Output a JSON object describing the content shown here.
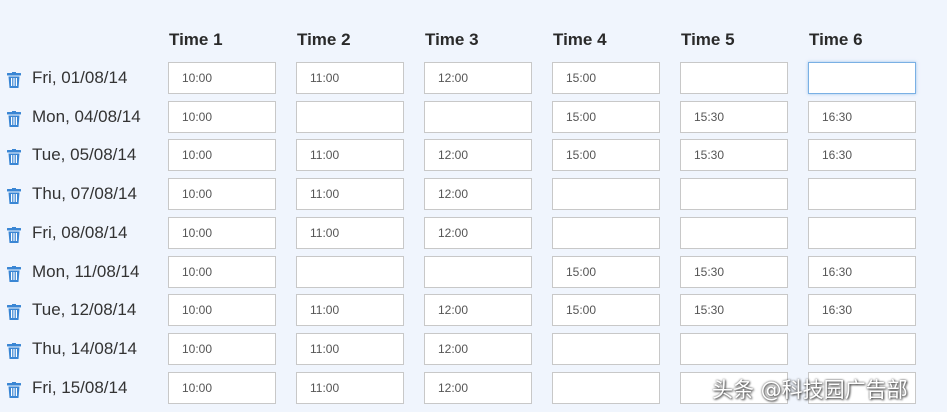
{
  "columns": [
    "Time 1",
    "Time 2",
    "Time 3",
    "Time 4",
    "Time 5",
    "Time 6"
  ],
  "icon": "trash-icon",
  "accent_color": "#3a86d4",
  "rows": [
    {
      "date": "Fri, 01/08/14",
      "times": [
        "10:00",
        "11:00",
        "12:00",
        "15:00",
        "",
        ""
      ]
    },
    {
      "date": "Mon, 04/08/14",
      "times": [
        "10:00",
        "",
        "",
        "15:00",
        "15:30",
        "16:30"
      ]
    },
    {
      "date": "Tue, 05/08/14",
      "times": [
        "10:00",
        "11:00",
        "12:00",
        "15:00",
        "15:30",
        "16:30"
      ]
    },
    {
      "date": "Thu, 07/08/14",
      "times": [
        "10:00",
        "11:00",
        "12:00",
        "",
        "",
        ""
      ]
    },
    {
      "date": "Fri, 08/08/14",
      "times": [
        "10:00",
        "11:00",
        "12:00",
        "",
        "",
        ""
      ]
    },
    {
      "date": "Mon, 11/08/14",
      "times": [
        "10:00",
        "",
        "",
        "15:00",
        "15:30",
        "16:30"
      ]
    },
    {
      "date": "Tue, 12/08/14",
      "times": [
        "10:00",
        "11:00",
        "12:00",
        "15:00",
        "15:30",
        "16:30"
      ]
    },
    {
      "date": "Thu, 14/08/14",
      "times": [
        "10:00",
        "11:00",
        "12:00",
        "",
        "",
        ""
      ]
    },
    {
      "date": "Fri, 15/08/14",
      "times": [
        "10:00",
        "11:00",
        "12:00",
        "",
        "",
        ""
      ]
    }
  ],
  "watermark": "头条 @科技园广告部"
}
